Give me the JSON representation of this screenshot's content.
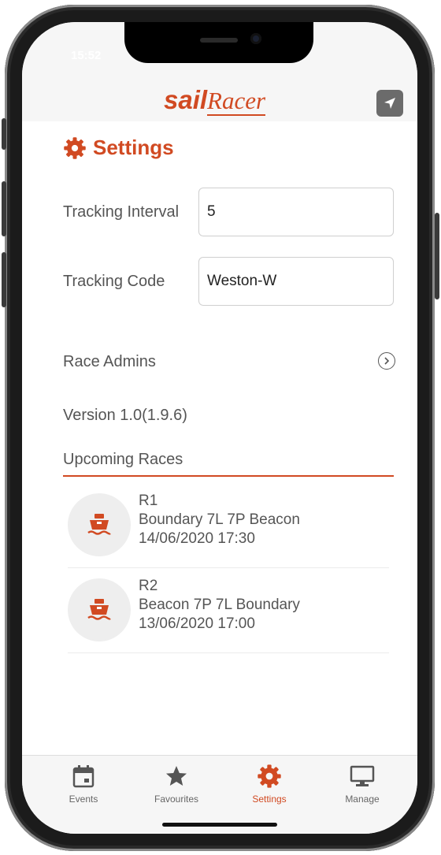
{
  "status_bar": {
    "time": "15:52"
  },
  "header": {
    "logo_sail": "sail",
    "logo_racer": "Racer"
  },
  "page": {
    "title": "Settings"
  },
  "form": {
    "tracking_interval_label": "Tracking Interval",
    "tracking_interval_value": "5",
    "tracking_code_label": "Tracking Code",
    "tracking_code_value": "Weston-W"
  },
  "race_admins": {
    "label": "Race Admins"
  },
  "version": "Version 1.0(1.9.6)",
  "upcoming": {
    "title": "Upcoming Races",
    "races": [
      {
        "name": "R1",
        "course": "Boundary 7L 7P Beacon",
        "datetime": "14/06/2020 17:30"
      },
      {
        "name": "R2",
        "course": "Beacon 7P 7L Boundary",
        "datetime": "13/06/2020 17:00"
      }
    ]
  },
  "tabs": [
    {
      "label": "Events",
      "icon": "calendar-icon"
    },
    {
      "label": "Favourites",
      "icon": "star-icon"
    },
    {
      "label": "Settings",
      "icon": "gear-icon",
      "active": true
    },
    {
      "label": "Manage",
      "icon": "monitor-icon"
    }
  ],
  "colors": {
    "accent": "#d14a22",
    "text": "#555555",
    "tab_inactive": "#666666"
  }
}
